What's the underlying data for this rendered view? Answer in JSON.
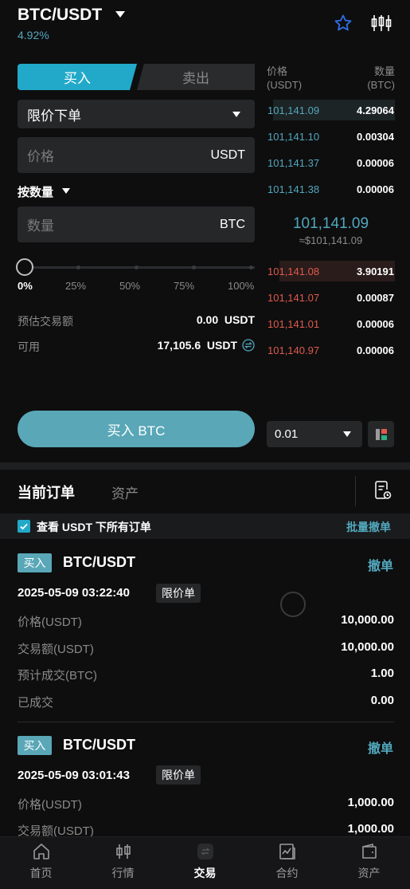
{
  "header": {
    "pair": "BTC/USDT",
    "change": "4.92%"
  },
  "trade": {
    "tab_buy": "买入",
    "tab_sell": "卖出",
    "order_type": "限价下单",
    "price_placeholder": "价格",
    "price_unit": "USDT",
    "by_qty_label": "按数量",
    "qty_placeholder": "数量",
    "qty_unit": "BTC",
    "slider_marks": [
      "0%",
      "25%",
      "50%",
      "75%",
      "100%"
    ],
    "slider_value_percent": 0,
    "est_label": "预估交易额",
    "est_value": "0.00  USDT",
    "avail_label": "可用",
    "avail_value": "17,105.6  USDT",
    "buy_button": "买入 BTC"
  },
  "orderbook": {
    "header_price": "价格",
    "header_price_unit": "(USDT)",
    "header_qty": "数量",
    "header_qty_unit": "(BTC)",
    "asks": [
      {
        "price": "101,141.09",
        "qty": "4.29064",
        "depth": 0.95
      },
      {
        "price": "101,141.10",
        "qty": "0.00304",
        "depth": 0
      },
      {
        "price": "101,141.37",
        "qty": "0.00006",
        "depth": 0
      },
      {
        "price": "101,141.38",
        "qty": "0.00006",
        "depth": 0
      }
    ],
    "mid_price": "101,141.09",
    "mid_usd": "≈$101,141.09",
    "bids": [
      {
        "price": "101,141.08",
        "qty": "3.90191",
        "depth": 0.9
      },
      {
        "price": "101,141.07",
        "qty": "0.00087",
        "depth": 0
      },
      {
        "price": "101,141.01",
        "qty": "0.00006",
        "depth": 0
      },
      {
        "price": "101,140.97",
        "qty": "0.00006",
        "depth": 0
      }
    ],
    "depth_value": "0.01",
    "colors": {
      "ask": "#52a8bd",
      "bid": "#e05a4d",
      "ask_bg": "#1d2426",
      "bid_bg": "#2a1c1b"
    }
  },
  "orders": {
    "tab_current": "当前订单",
    "tab_assets": "资产",
    "filter_label": "查看 USDT 下所有订单",
    "batch_cancel": "批量撤单",
    "items": [
      {
        "side": "买入",
        "pair": "BTC/USDT",
        "cancel": "撤单",
        "time": "2025-05-09 03:22:40",
        "type": "限价单",
        "rows": [
          {
            "label": "价格(USDT)",
            "value": "10,000.00"
          },
          {
            "label": "交易额(USDT)",
            "value": "10,000.00"
          },
          {
            "label": "预计成交(BTC)",
            "value": "1.00"
          },
          {
            "label": "已成交",
            "value": "0.00"
          }
        ]
      },
      {
        "side": "买入",
        "pair": "BTC/USDT",
        "cancel": "撤单",
        "time": "2025-05-09 03:01:43",
        "type": "限价单",
        "rows": [
          {
            "label": "价格(USDT)",
            "value": "1,000.00"
          },
          {
            "label": "交易额(USDT)",
            "value": "1,000.00"
          }
        ]
      }
    ]
  },
  "nav": [
    {
      "label": "首页",
      "icon": "home-icon"
    },
    {
      "label": "行情",
      "icon": "market-icon"
    },
    {
      "label": "交易",
      "icon": "trade-icon"
    },
    {
      "label": "合约",
      "icon": "contract-icon"
    },
    {
      "label": "资产",
      "icon": "wallet-icon"
    }
  ]
}
